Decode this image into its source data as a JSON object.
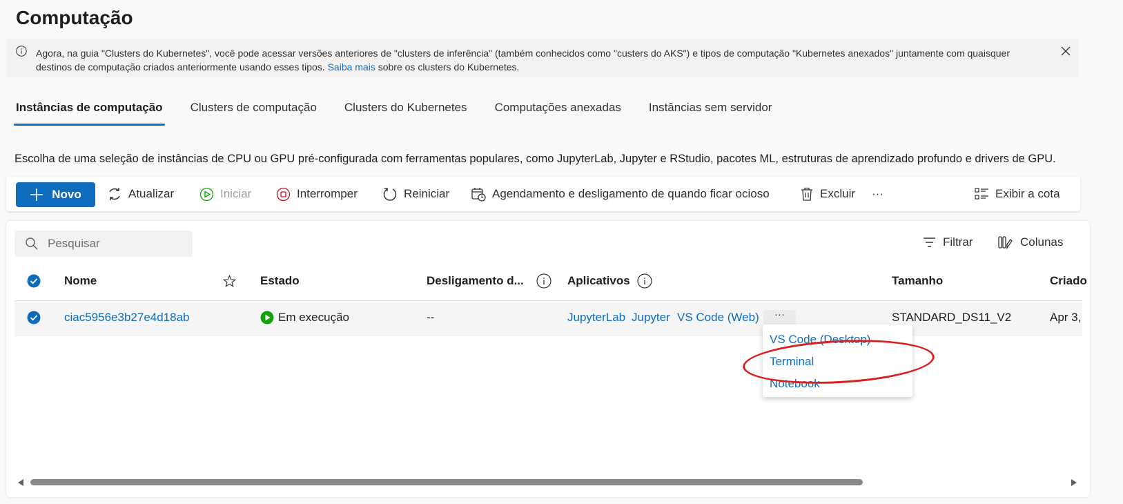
{
  "page": {
    "title": "Computação"
  },
  "banner": {
    "text_before": "Agora, na guia \"Clusters do Kubernetes\", você pode acessar versões anteriores de \"clusters de inferência\" (também conhecidos como \"custers do AKS\") e tipos de computação \"Kubernetes anexados\" juntamente com quaisquer destinos de computação criados anteriormente usando esses tipos.",
    "link": "Saiba mais",
    "text_after": "sobre os clusters do Kubernetes."
  },
  "tabs": [
    {
      "label": "Instâncias de computação",
      "active": true
    },
    {
      "label": "Clusters de computação"
    },
    {
      "label": "Clusters do Kubernetes"
    },
    {
      "label": "Computações anexadas"
    },
    {
      "label": "Instâncias sem servidor"
    }
  ],
  "description": "Escolha de uma seleção de instâncias de CPU ou GPU pré-configurada com ferramentas populares, como JupyterLab, Jupyter e RStudio, pacotes ML, estruturas de aprendizado profundo e drivers de GPU.",
  "toolbar": {
    "new": "Novo",
    "refresh": "Atualizar",
    "start": "Iniciar",
    "stop": "Interromper",
    "restart": "Reiniciar",
    "schedule": "Agendamento e desligamento de quando ficar ocioso",
    "delete": "Excluir",
    "more": "···",
    "quota": "Exibir a cota"
  },
  "search": {
    "placeholder": "Pesquisar"
  },
  "filter_label": "Filtrar",
  "columns_label": "Colunas",
  "table": {
    "headers": {
      "name": "Nome",
      "state": "Estado",
      "shutdown": "Desligamento d...",
      "apps": "Aplicativos",
      "size": "Tamanho",
      "created": "Criado"
    },
    "rows": [
      {
        "name": "ciac5956e3b27e4d18ab",
        "state": "Em execução",
        "shutdown": "--",
        "apps": [
          "JupyterLab",
          "Jupyter",
          "VS Code (Web)"
        ],
        "apps_more": "···",
        "size": "STANDARD_DS11_V2",
        "created": "Apr 3,"
      }
    ]
  },
  "apps_menu": [
    "VS Code (Desktop)",
    "Terminal",
    "Notebook"
  ],
  "colors": {
    "accent": "#0f6cbd",
    "running": "#13a10e",
    "annotation": "#d92020"
  }
}
